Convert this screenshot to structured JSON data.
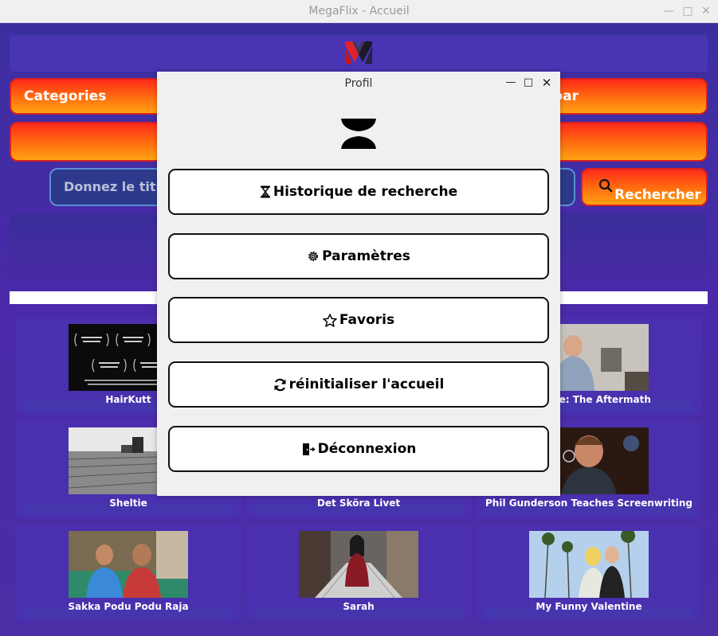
{
  "window": {
    "title": "MegaFlix - Accueil"
  },
  "nav": {
    "categories_label": "Categories",
    "sort_label": "par"
  },
  "search": {
    "placeholder": "Donnez le titre",
    "button_label": "Rechercher"
  },
  "movies": [
    {
      "title": "HairKutt"
    },
    {
      "title": "Debate: The Aftermath"
    },
    {
      "title": "Sheltie"
    },
    {
      "title": "Det Sköra Livet"
    },
    {
      "title": "Phil Gunderson Teaches Screenwriting"
    },
    {
      "title": "Sakka Podu Podu Raja"
    },
    {
      "title": "Sarah"
    },
    {
      "title": "My Funny Valentine"
    }
  ],
  "profile_dialog": {
    "title": "Profil",
    "items": [
      {
        "label": "Historique de recherche",
        "icon": "hourglass-icon"
      },
      {
        "label": "Paramètres",
        "icon": "gear-icon"
      },
      {
        "label": "Favoris",
        "icon": "star-icon"
      },
      {
        "label": "réinitialiser l'accueil",
        "icon": "refresh-icon"
      },
      {
        "label": "Déconnexion",
        "icon": "logout-icon"
      }
    ]
  }
}
